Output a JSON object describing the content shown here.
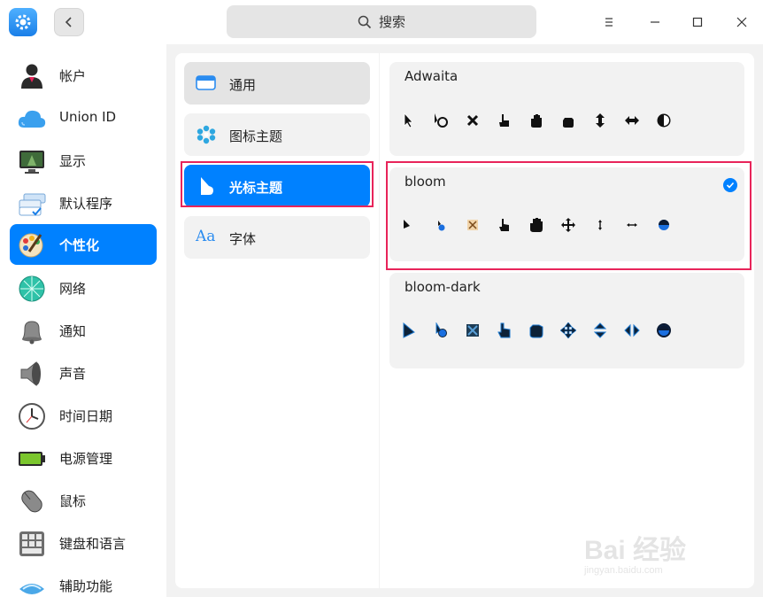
{
  "titlebar": {
    "search_label": "搜索",
    "icons": [
      "settings-app-icon",
      "back-arrow-icon",
      "search-icon",
      "menu-icon",
      "minimize-icon",
      "maximize-icon",
      "close-icon"
    ]
  },
  "sidebar": {
    "items": [
      {
        "label": "帐户",
        "icon": "account-icon"
      },
      {
        "label": "Union ID",
        "icon": "cloud-icon"
      },
      {
        "label": "显示",
        "icon": "display-icon"
      },
      {
        "label": "默认程序",
        "icon": "default-apps-icon"
      },
      {
        "label": "个性化",
        "icon": "personalization-icon",
        "active": true
      },
      {
        "label": "网络",
        "icon": "network-icon"
      },
      {
        "label": "通知",
        "icon": "bell-icon"
      },
      {
        "label": "声音",
        "icon": "speaker-icon"
      },
      {
        "label": "时间日期",
        "icon": "clock-icon"
      },
      {
        "label": "电源管理",
        "icon": "battery-icon"
      },
      {
        "label": "鼠标",
        "icon": "mouse-icon"
      },
      {
        "label": "键盘和语言",
        "icon": "keyboard-icon"
      },
      {
        "label": "辅助功能",
        "icon": "accessibility-icon"
      }
    ]
  },
  "categories": [
    {
      "label": "通用",
      "icon": "window-icon"
    },
    {
      "label": "图标主题",
      "icon": "icon-theme-icon"
    },
    {
      "label": "光标主题",
      "icon": "cursor-theme-icon",
      "active": true
    },
    {
      "label": "字体",
      "icon": "font-icon",
      "glyph": "Aa"
    }
  ],
  "themes": [
    {
      "name": "Adwaita",
      "selected": false,
      "style": "adwaita"
    },
    {
      "name": "bloom",
      "selected": true,
      "style": "bloom"
    },
    {
      "name": "bloom-dark",
      "selected": false,
      "style": "bloom-dark"
    }
  ],
  "watermark": {
    "main": "Bai 经验",
    "sub": "jingyan.baidu.com"
  },
  "colors": {
    "accent": "#0081ff",
    "highlight_border": "#e8245a",
    "panel_bg": "#f2f2f2"
  }
}
